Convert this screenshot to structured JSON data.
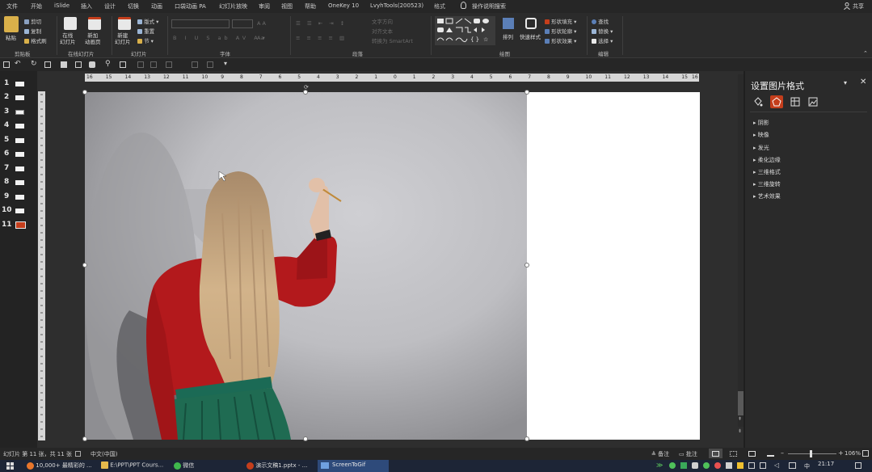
{
  "menubar": {
    "tabs": [
      "文件",
      "开始",
      "iSlide",
      "插入",
      "设计",
      "切换",
      "动画",
      "口袋动画 PA",
      "幻灯片放映",
      "审阅",
      "视图",
      "帮助",
      "OneKey 10",
      "LvyhTools(200523)",
      "格式"
    ],
    "tell_me": "操作说明搜索",
    "share": "共享"
  },
  "ribbon": {
    "clipboard": {
      "paste": "粘贴",
      "cut": "剪切",
      "copy": "复制",
      "format_painter": "格式刷",
      "group": "剪贴板"
    },
    "online": {
      "online_slide": "在线\n幻灯片",
      "new_anim": "新加\n动画页",
      "group": "在线幻灯片"
    },
    "slides": {
      "new_slide": "新建\n幻灯片",
      "layout": "版式",
      "reset": "重置",
      "section": "节",
      "group": "幻灯片"
    },
    "font": {
      "group": "字体"
    },
    "paragraph": {
      "text_dir": "文字方向",
      "align_text": "对齐文本",
      "smartart": "转换为 SmartArt",
      "group": "段落"
    },
    "drawing": {
      "arrange": "排列",
      "quick_styles": "快速样式",
      "shape_fill": "形状填充",
      "shape_outline": "形状轮廓",
      "shape_effects": "形状效果",
      "group": "绘图"
    },
    "editing": {
      "find": "查找",
      "replace": "替换",
      "select": "选择",
      "group": "编辑"
    }
  },
  "rulers": {
    "h": [
      "16",
      "15",
      "14",
      "13",
      "12",
      "11",
      "10",
      "9",
      "8",
      "7",
      "6",
      "5",
      "4",
      "3",
      "2",
      "1",
      "0",
      "1",
      "2",
      "3",
      "4",
      "5",
      "6",
      "7",
      "8",
      "9",
      "10",
      "11",
      "12",
      "13",
      "14",
      "15",
      "16"
    ]
  },
  "slides_panel": {
    "numbers": [
      "1",
      "2",
      "3",
      "4",
      "5",
      "6",
      "7",
      "8",
      "9",
      "10",
      "11"
    ],
    "active": "11"
  },
  "format_pane": {
    "title": "设置图片格式",
    "sections": [
      "阴影",
      "映像",
      "发光",
      "柔化边缘",
      "三维格式",
      "三维旋转",
      "艺术效果"
    ]
  },
  "status": {
    "slide_info": "幻灯片 第 11 张，共 11 张",
    "language": "中文(中国)",
    "notes": "备注",
    "comments": "批注",
    "zoom": "106%"
  },
  "taskbar": {
    "items": [
      "10,000+ 最精彩的 ...",
      "E:\\PPT\\PPT Cours...",
      "微信",
      "演示文稿1.pptx - ...",
      "ScreenToGif"
    ],
    "time": "21:17"
  },
  "colors": {
    "accent": "#c43e1c",
    "sweater": "#b3191c",
    "skirt": "#1f6b52",
    "hair": "#c9a77d"
  }
}
